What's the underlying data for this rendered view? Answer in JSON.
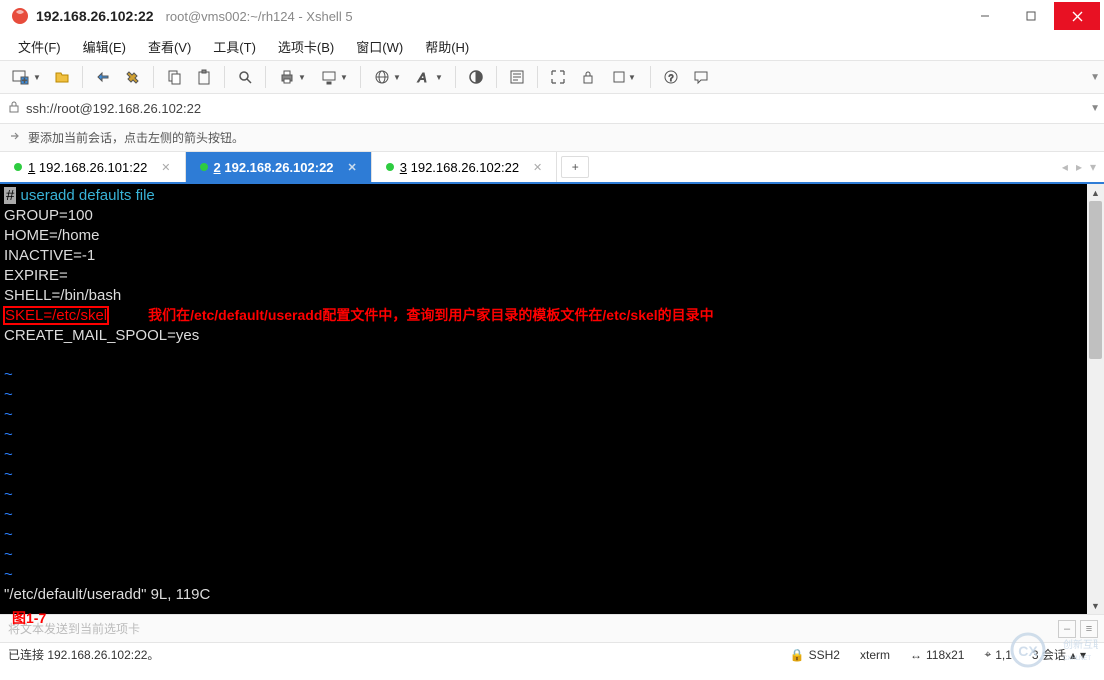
{
  "window": {
    "host": "192.168.26.102:22",
    "subtitle": "root@vms002:~/rh124 - Xshell 5"
  },
  "menu": {
    "file": "文件(F)",
    "edit": "编辑(E)",
    "view": "查看(V)",
    "tools": "工具(T)",
    "tabs": "选项卡(B)",
    "window": "窗口(W)",
    "help": "帮助(H)"
  },
  "address": {
    "url": "ssh://root@192.168.26.102:22"
  },
  "hint": {
    "text": "要添加当前会话，点击左侧的箭头按钮。"
  },
  "tabs": [
    {
      "num": "1",
      "label": "192.168.26.101:22",
      "active": false
    },
    {
      "num": "2",
      "label": "192.168.26.102:22",
      "active": true
    },
    {
      "num": "3",
      "label": "192.168.26.102:22",
      "active": false
    }
  ],
  "terminal": {
    "lines": {
      "comment": " useradd defaults file",
      "l1": "GROUP=100",
      "l2": "HOME=/home",
      "l3": "INACTIVE=-1",
      "l4": "EXPIRE=",
      "l5": "SHELL=/bin/bash",
      "l6": "SKEL=/etc/skel",
      "annot": "我们在/etc/default/useradd配置文件中，查询到用户家目录的模板文件在/etc/skel的目录中",
      "l7": "CREATE_MAIL_SPOOL=yes",
      "status": "\"/etc/default/useradd\" 9L, 119C"
    }
  },
  "figure": "图1-7",
  "input": {
    "placeholder": "将文本发送到当前选项卡"
  },
  "status": {
    "connected": "已连接 192.168.26.102:22。",
    "proto": "SSH2",
    "term": "xterm",
    "size": "118x21",
    "pos": "1,1",
    "sessions": "3 会话"
  },
  "icons": {
    "hash": "#"
  }
}
